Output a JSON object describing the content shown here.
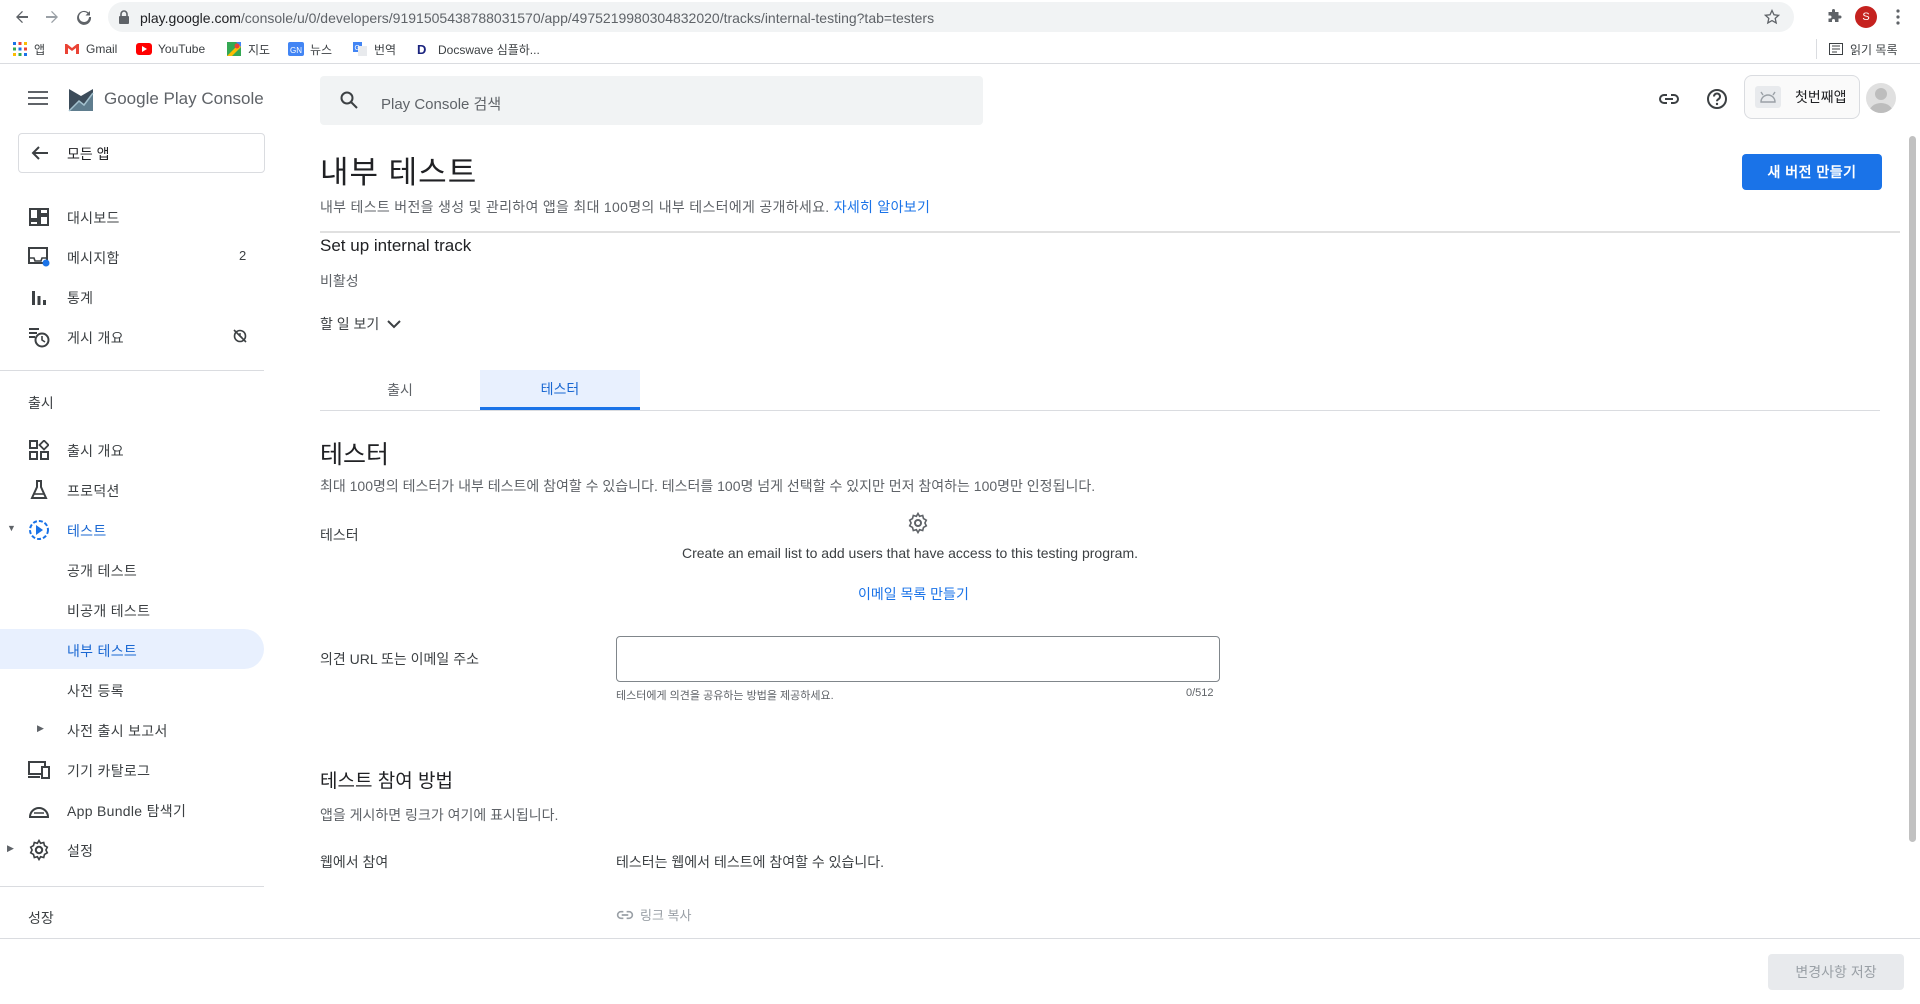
{
  "browser": {
    "url_host": "play.google.com",
    "url_path": "/console/u/0/developers/9191505438788031570/app/4975219980304832020/tracks/internal-testing?tab=testers",
    "profile_initial": "S",
    "bookmarks": [
      "앱",
      "Gmail",
      "YouTube",
      "지도",
      "뉴스",
      "번역",
      "Docswave 심플하..."
    ],
    "reading_list": "읽기 목록"
  },
  "header": {
    "product_name": "Google Play Console",
    "search_placeholder": "Play Console 검색",
    "app_name": "첫번째앱"
  },
  "sidebar": {
    "all_apps": "모든 앱",
    "top_items": [
      {
        "label": "대시보드",
        "icon": "dashboard-icon"
      },
      {
        "label": "메시지함",
        "icon": "inbox-icon",
        "badge": "2"
      },
      {
        "label": "통계",
        "icon": "stats-icon"
      },
      {
        "label": "게시 개요",
        "icon": "publishing-overview-icon"
      }
    ],
    "release_section": "출시",
    "release_items": [
      {
        "label": "출시 개요"
      },
      {
        "label": "프로덕션"
      },
      {
        "label": "테스트"
      },
      {
        "label": "공개 테스트"
      },
      {
        "label": "비공개 테스트"
      },
      {
        "label": "내부 테스트"
      },
      {
        "label": "사전 등록"
      },
      {
        "label": "사전 출시 보고서"
      },
      {
        "label": "기기 카탈로그"
      },
      {
        "label": "App Bundle 탐색기"
      },
      {
        "label": "설정"
      }
    ],
    "growth_section": "성장"
  },
  "main": {
    "title": "내부 테스트",
    "description": "내부 테스트 버전을 생성 및 관리하여 앱을 최대 100명의 내부 테스터에게 공개하세요.",
    "learn_more": "자세히 알아보기",
    "new_release_button": "새 버전 만들기",
    "setup_title": "Set up internal track",
    "setup_status": "비활성",
    "todo_label": "할 일 보기",
    "tabs": [
      {
        "label": "출시",
        "active": false
      },
      {
        "label": "테스터",
        "active": true
      }
    ],
    "testers_heading": "테스터",
    "testers_desc": "최대 100명의 테스터가 내부 테스트에 참여할 수 있습니다. 테스터를 100명 넘게 선택할 수 있지만 먼저 참여하는 100명만 인정됩니다.",
    "testers_label": "테스터",
    "empty_list_text": "Create an email list to add users that have access to this testing program.",
    "create_list_link": "이메일 목록 만들기",
    "feedback_label": "의견 URL 또는 이메일 주소",
    "feedback_value": "",
    "feedback_helper": "테스터에게 의견을 공유하는 방법을 제공하세요.",
    "feedback_counter": "0/512",
    "join_heading": "테스트 참여 방법",
    "join_desc": "앱을 게시하면 링크가 여기에 표시됩니다.",
    "join_web_label": "웹에서 참여",
    "join_web_text": "테스터는 웹에서 테스트에 참여할 수 있습니다.",
    "copy_link": "링크 복사",
    "save_button": "변경사항 저장"
  },
  "colors": {
    "accent": "#1a73e8",
    "active_bg": "#e8f0fe"
  }
}
